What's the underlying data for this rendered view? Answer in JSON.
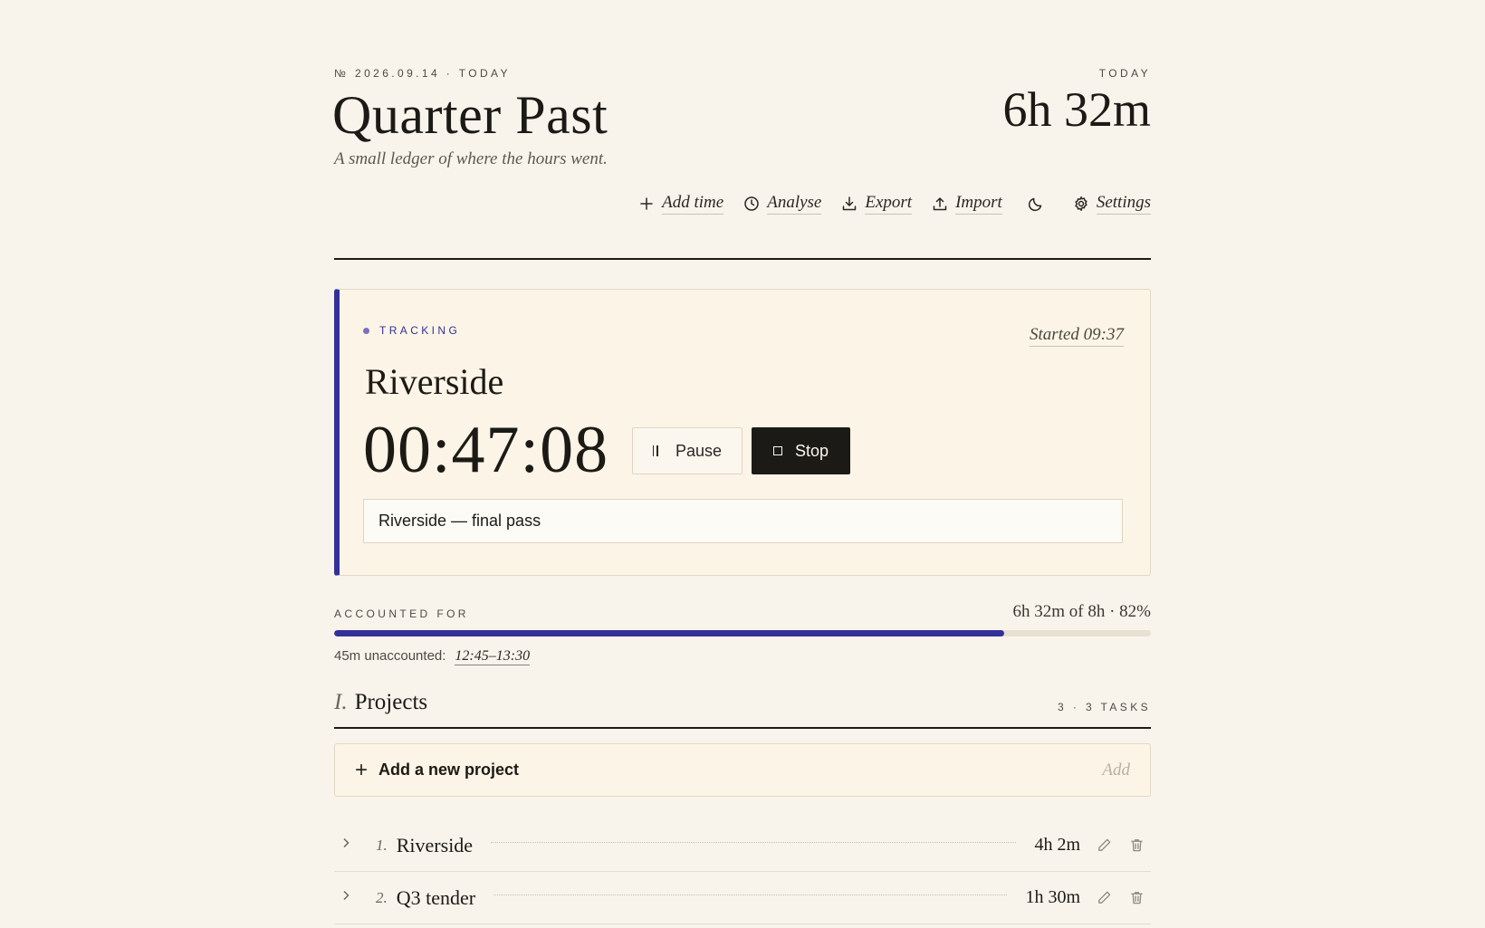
{
  "header": {
    "issue": "№ 2026.09.14 · TODAY",
    "title": "Quarter Past",
    "subtitle": "A small ledger of where the hours went.",
    "today_label": "TODAY",
    "today_total": "6h 32m"
  },
  "toolbar": {
    "add_time": "Add time",
    "analyse": "Analyse",
    "export": "Export",
    "import": "Import",
    "settings": "Settings"
  },
  "tracker": {
    "status": "TRACKING",
    "started": "Started 09:37",
    "project": "Riverside",
    "elapsed": "00:47:08",
    "pause_label": "Pause",
    "stop_label": "Stop",
    "description": "Riverside — final pass",
    "accent": "#34309a"
  },
  "accounted": {
    "label": "ACCOUNTED FOR",
    "value": "6h 32m of 8h · 82%",
    "percent": 82,
    "unaccounted_label": "45m unaccounted:",
    "unaccounted_range": "12:45–13:30"
  },
  "projects": {
    "numeral": "I.",
    "title": "Projects",
    "count": "3 · 3 TASKS",
    "add_placeholder": "Add a new project",
    "add_button": "Add",
    "items": [
      {
        "index": "1.",
        "name": "Riverside",
        "duration": "4h 2m"
      },
      {
        "index": "2.",
        "name": "Q3 tender",
        "duration": "1h 30m"
      }
    ]
  }
}
